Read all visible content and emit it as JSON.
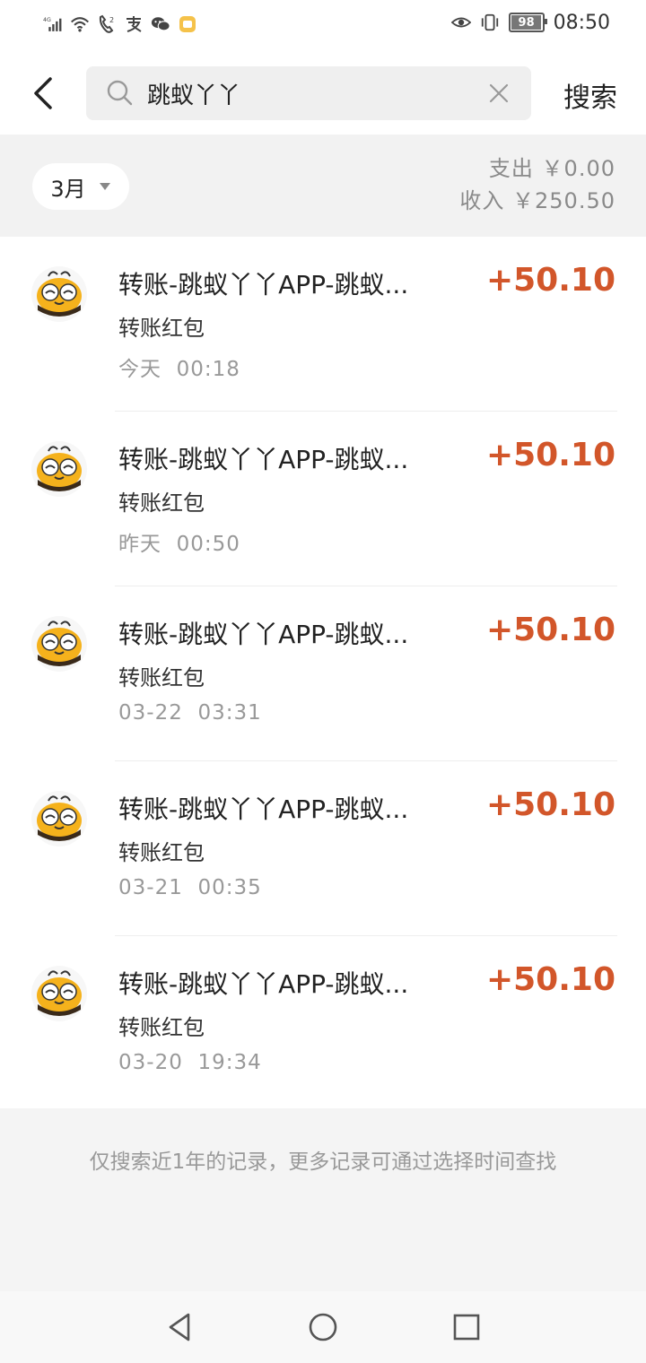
{
  "status_bar": {
    "network": "4G",
    "battery": "98",
    "battery_level": 0.98,
    "time": "08:50",
    "icons": [
      "signal-icon",
      "wifi-icon",
      "hd-call-icon",
      "alipay-icon",
      "wechat-icon",
      "notification-icon",
      "eye-comfort-icon",
      "vibrate-icon",
      "battery-icon"
    ]
  },
  "header": {
    "search_value": "跳蚁丫丫",
    "search_button": "搜索",
    "icons": [
      "back-icon",
      "search-icon",
      "clear-icon"
    ]
  },
  "summary": {
    "month": "3月",
    "expense": "支出 ￥0.00",
    "income": "收入 ￥250.50"
  },
  "transactions": [
    {
      "title": "转账-跳蚁丫丫APP-跳蚁...",
      "subtitle": "转账红包",
      "time": "今天  00:18",
      "amount": "+50.10"
    },
    {
      "title": "转账-跳蚁丫丫APP-跳蚁...",
      "subtitle": "转账红包",
      "time": "昨天  00:50",
      "amount": "+50.10"
    },
    {
      "title": "转账-跳蚁丫丫APP-跳蚁...",
      "subtitle": "转账红包",
      "time": "03-22  03:31",
      "amount": "+50.10"
    },
    {
      "title": "转账-跳蚁丫丫APP-跳蚁...",
      "subtitle": "转账红包",
      "time": "03-21  00:35",
      "amount": "+50.10"
    },
    {
      "title": "转账-跳蚁丫丫APP-跳蚁...",
      "subtitle": "转账红包",
      "time": "03-20  19:34",
      "amount": "+50.10"
    }
  ],
  "footer_note": "仅搜索近1年的记录，更多记录可通过选择时间查找",
  "colors": {
    "amount": "#d2562a",
    "accent_yellow": "#f5b21c"
  },
  "nav_icons": [
    "nav-back-icon",
    "nav-home-icon",
    "nav-recents-icon"
  ]
}
